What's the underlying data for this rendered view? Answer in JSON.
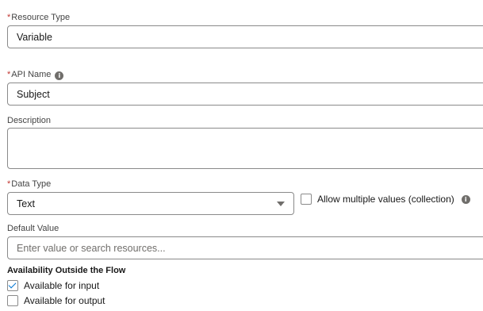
{
  "resource_type": {
    "required_mark": "*",
    "label": "Resource Type",
    "value": "Variable"
  },
  "api_name": {
    "required_mark": "*",
    "label": "API Name",
    "info_icon": "info-icon",
    "value": "Subject"
  },
  "description": {
    "label": "Description",
    "value": ""
  },
  "data_type": {
    "required_mark": "*",
    "label": "Data Type",
    "selected": "Text",
    "allow_multiple_label": "Allow multiple values (collection)",
    "allow_multiple_checked": false
  },
  "default_value": {
    "label": "Default Value",
    "placeholder": "Enter value or search resources..."
  },
  "availability": {
    "title": "Availability Outside the Flow",
    "input_label": "Available for input",
    "input_checked": true,
    "output_label": "Available for output",
    "output_checked": false
  },
  "colors": {
    "required": "#c23934",
    "border": "#8a8a8a",
    "check": "#0176d3",
    "info_icon_bg": "#706e6b"
  }
}
